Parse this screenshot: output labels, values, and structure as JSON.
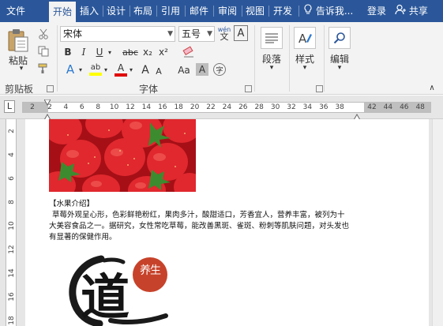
{
  "tabs": [
    {
      "label": "文件",
      "active": false
    },
    {
      "label": "开始",
      "active": true
    },
    {
      "label": "插入",
      "active": false
    },
    {
      "label": "设计",
      "active": false
    },
    {
      "label": "布局",
      "active": false
    },
    {
      "label": "引用",
      "active": false
    },
    {
      "label": "邮件",
      "active": false
    },
    {
      "label": "审阅",
      "active": false
    },
    {
      "label": "视图",
      "active": false
    },
    {
      "label": "开发",
      "active": false
    }
  ],
  "tellme": "告诉我...",
  "login": "登录",
  "share": "共享",
  "clipboard": {
    "paste_label": "粘贴",
    "group_label": "剪贴板"
  },
  "font": {
    "name": "宋体",
    "size": "五号",
    "wen_label": "wén",
    "a_box": "A",
    "group_label": "字体",
    "bold": "B",
    "italic": "I",
    "underline": "U",
    "strike": "abc",
    "sub": "x₂",
    "sup": "x²",
    "effects": "A",
    "highlight": "ab",
    "color": "A",
    "grow": "A",
    "shrink": "A",
    "case": "Aa",
    "shade": "A",
    "circle": "字"
  },
  "paragraph": {
    "label": "段落"
  },
  "styles": {
    "label": "样式"
  },
  "editing": {
    "label": "编辑"
  },
  "ruler": {
    "corner": "L",
    "ticks": [
      "2",
      "2",
      "4",
      "6",
      "8",
      "10",
      "12",
      "14",
      "16",
      "18",
      "20",
      "22",
      "24",
      "26",
      "28",
      "30",
      "32",
      "34",
      "36",
      "38",
      "42",
      "44",
      "46",
      "48"
    ],
    "vticks": [
      "2",
      "4",
      "6",
      "8",
      "10",
      "12",
      "14",
      "16",
      "18"
    ]
  },
  "doc": {
    "heading": "【水果介绍】",
    "line1": "草莓外观呈心形，色彩鲜艳粉红，果肉多汁，酸甜适口，芳香宜人，营养丰富，被列为十",
    "line2": "大美容食品之一。据研究，女性常吃草莓，能改善黑斑、雀斑、粉刺等肌肤问题，对头发也",
    "line3": "有显著的保健作用。",
    "logo_char": "养生"
  },
  "colors": {
    "word_blue": "#2b579a",
    "highlight": "#ffff00",
    "font_color": "#e00000"
  }
}
